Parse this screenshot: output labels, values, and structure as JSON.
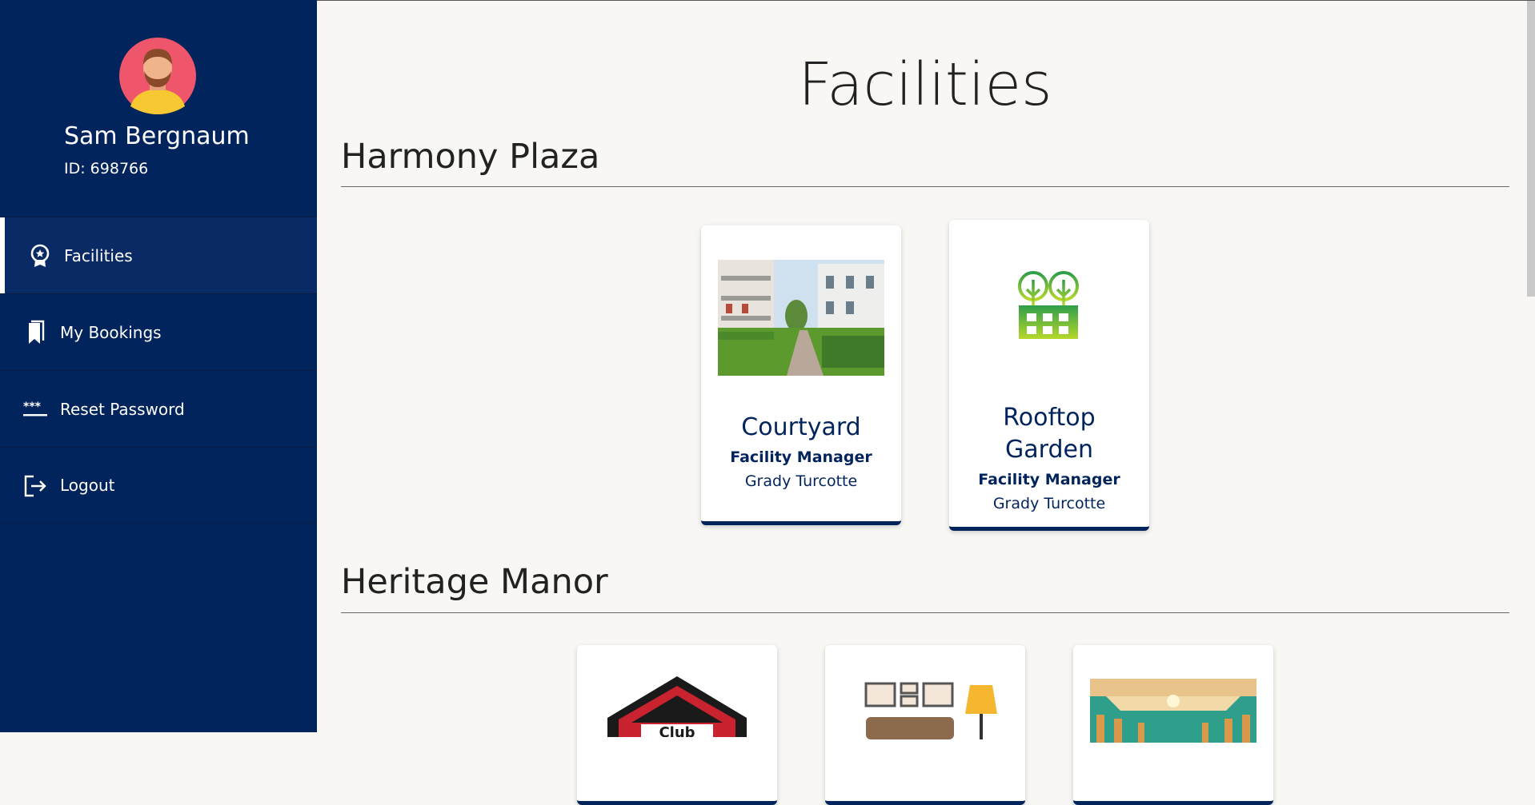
{
  "user": {
    "name": "Sam Bergnaum",
    "id": "ID: 698766"
  },
  "nav": {
    "facilities": "Facilities",
    "bookings": "My Bookings",
    "reset_password": "Reset Password",
    "logout": "Logout"
  },
  "page": {
    "title": "Facilities"
  },
  "sections": [
    {
      "title": "Harmony Plaza",
      "cards": [
        {
          "name": "Courtyard",
          "role": "Facility Manager",
          "manager": "Grady Turcotte"
        },
        {
          "name": "Rooftop Garden",
          "role": "Facility Manager",
          "manager": "Grady Turcotte"
        }
      ]
    },
    {
      "title": "Heritage Manor",
      "cards": [
        {
          "name": "Club",
          "role": "",
          "manager": ""
        },
        {
          "name": "",
          "role": "",
          "manager": ""
        },
        {
          "name": "",
          "role": "",
          "manager": ""
        }
      ]
    }
  ],
  "colors": {
    "sidebar": "#02245c",
    "accent": "#02245c",
    "background": "#f8f7f4"
  }
}
